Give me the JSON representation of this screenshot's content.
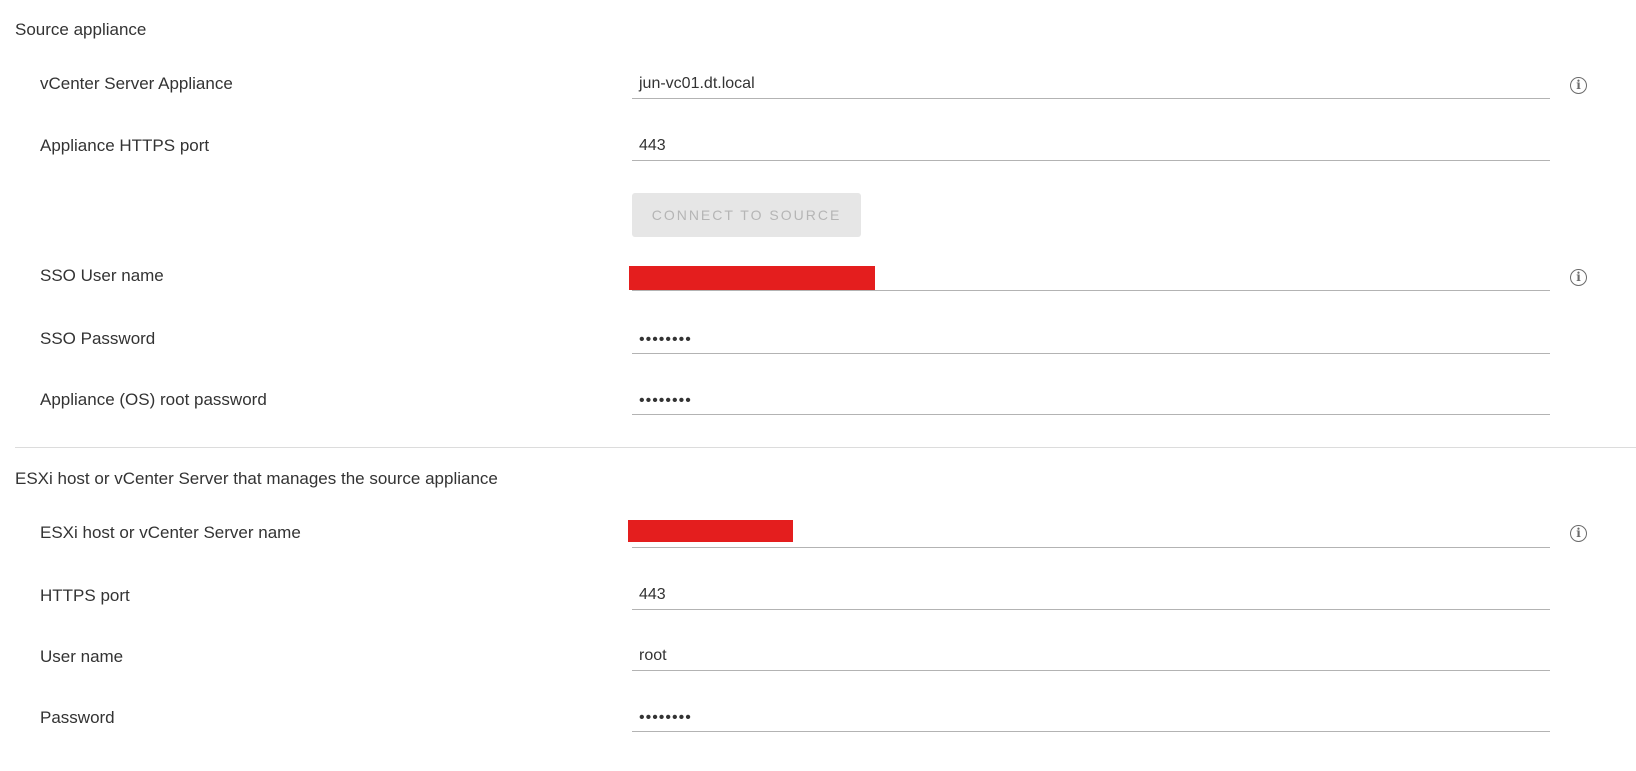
{
  "source": {
    "title": "Source appliance",
    "vcsa": {
      "label": "vCenter Server Appliance",
      "value": "jun-vc01.dt.local"
    },
    "https_port": {
      "label": "Appliance HTTPS port",
      "value": "443"
    },
    "connect_button": "CONNECT TO SOURCE",
    "sso_user": {
      "label": "SSO User name",
      "value": ""
    },
    "sso_password": {
      "label": "SSO Password",
      "value": "••••••••"
    },
    "root_password": {
      "label": "Appliance (OS) root password",
      "value": "••••••••"
    }
  },
  "host": {
    "title": "ESXi host or vCenter Server that manages the source appliance",
    "name": {
      "label": "ESXi host or vCenter Server name",
      "value": ""
    },
    "https_port": {
      "label": "HTTPS port",
      "value": "443"
    },
    "user": {
      "label": "User name",
      "value": "root"
    },
    "password": {
      "label": "Password",
      "value": "••••••••"
    }
  },
  "info_icon": "i",
  "colors": {
    "redaction": "#e41e1e",
    "disabled_button_bg": "#e6e6e6",
    "underline": "#b3b3b3"
  }
}
